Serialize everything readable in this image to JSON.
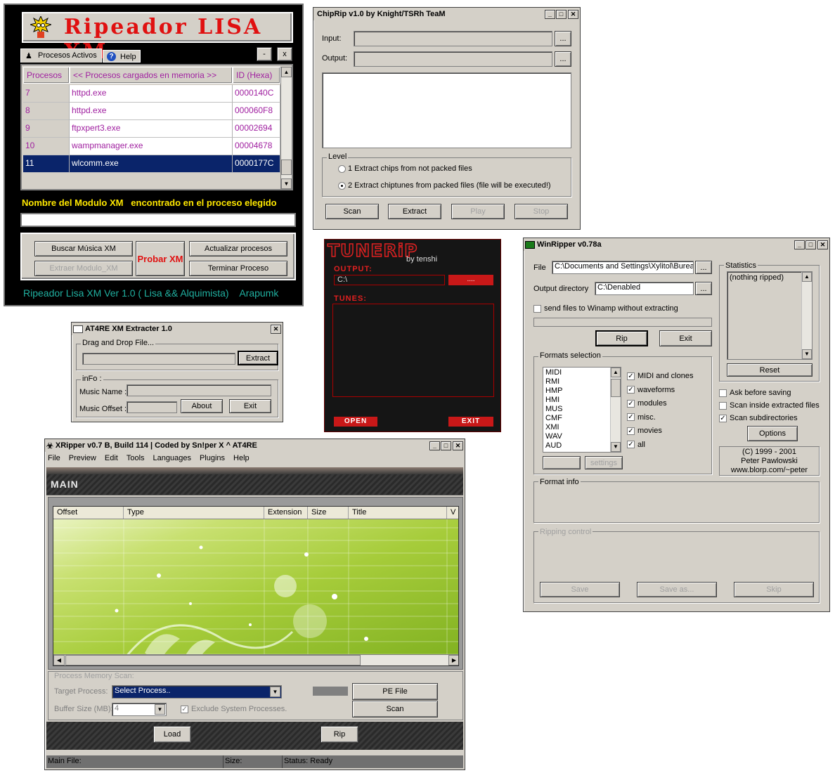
{
  "lisa": {
    "title": "Ripeador LISA XM",
    "tabs": [
      "Procesos Activos",
      "Help"
    ],
    "min_label": "-",
    "close_label": "x",
    "headers": [
      "Procesos",
      "<< Procesos cargados en memoria >>",
      "ID (Hexa)"
    ],
    "rows": [
      {
        "n": "7",
        "name": "httpd.exe",
        "id": "0000140C"
      },
      {
        "n": "8",
        "name": "httpd.exe",
        "id": "000060F8"
      },
      {
        "n": "9",
        "name": "ftpxpert3.exe",
        "id": "00002694"
      },
      {
        "n": "10",
        "name": "wampmanager.exe",
        "id": "00004678"
      },
      {
        "n": "11",
        "name": "wlcomm.exe",
        "id": "0000177C"
      }
    ],
    "module_label": "Nombre del Modulo XM   encontrado en el proceso elegido",
    "buttons": {
      "search": "Buscar Música XM",
      "extract": "Extraer Modulo_XM",
      "try": "Probar XM",
      "refresh": "Actualizar procesos",
      "terminate": "Terminar Proceso"
    },
    "footer": "Ripeador Lisa XM Ver 1.0 ( Lisa && Alquimista)    Arapumk"
  },
  "chiprip": {
    "title": "ChipRip v1.0 by Knight/TSRh TeaM",
    "input_label": "Input:",
    "output_label": "Output:",
    "browse": "...",
    "level_label": "Level",
    "opt1": "1 Extract chips from not packed files",
    "opt2": "2 Extract chiptunes from packed files (file will be executed!)",
    "buttons": [
      "Scan",
      "Extract",
      "Play",
      "Stop"
    ]
  },
  "tunerip": {
    "logo": "TUNERiP",
    "byline": "by tenshi",
    "output_label": "OUTPUT:",
    "output_value": "C:\\",
    "browse": "....",
    "tunes_label": "TUNES:",
    "open": "OPEN",
    "exit": "EXIT"
  },
  "winripper": {
    "title": "WinRipper v0.78a",
    "file_label": "File",
    "file_value": "C:\\Documents and Settings\\Xylitol\\Burea",
    "outdir_label": "Output directory",
    "outdir_value": "C:\\Denabled",
    "browse": "...",
    "winamp_label": "send files to Winamp without extracting",
    "rip": "Rip",
    "exit": "Exit",
    "formats_label": "Formats selection",
    "formats": [
      "MIDI",
      "RMI",
      "HMP",
      "HMI",
      "MUS",
      "CMF",
      "XMI",
      "WAV",
      "AUD"
    ],
    "checks": [
      "MIDI and clones",
      "waveforms",
      "modules",
      "misc.",
      "movies",
      "all"
    ],
    "settings": "settings",
    "stats_label": "Statistics",
    "stats_value": "(nothing ripped)",
    "reset": "Reset",
    "opts": [
      {
        "label": "Ask before saving",
        "checked": false
      },
      {
        "label": "Scan inside extracted files",
        "checked": false
      },
      {
        "label": "Scan subdirectories",
        "checked": true
      }
    ],
    "options": "Options",
    "credits": [
      "(C) 1999 - 2001",
      "Peter Pawlowski",
      "www.blorp.com/~peter"
    ],
    "format_info": "Format info",
    "ripping_control": "Ripping control",
    "save": "Save",
    "save_as": "Save as...",
    "skip": "Skip"
  },
  "at4re": {
    "title": "AT4RE XM Extracter 1.0",
    "drag_label": "Drag and Drop File...",
    "extract": "Extract",
    "info_label": "inFo :",
    "music_name": "Music Name :",
    "music_offset": "Music Offset :",
    "about": "About",
    "exit": "Exit"
  },
  "xripper": {
    "title": "XRipper v0.7 B, Build 114 | Coded by Sn!per X ^ AT4RE",
    "menu": [
      "File",
      "Preview",
      "Edit",
      "Tools",
      "Languages",
      "Plugins",
      "Help"
    ],
    "banner": "MAIN",
    "columns": [
      "Offset",
      "Type",
      "Extension",
      "Size",
      "Title",
      "V"
    ],
    "scan_label": "Process Memory Scan:",
    "target_label": "Target Process:",
    "target_value": "Select Process..",
    "buffer_label": "Buffer Size (MB):",
    "buffer_value": "4",
    "exclude_label": "Exclude System Processes.",
    "pe_file": "PE File",
    "scan": "Scan",
    "load": "Load",
    "rip": "Rip",
    "status": {
      "main_file": "Main File:",
      "size": "Size:",
      "state": "Status: Ready"
    }
  }
}
